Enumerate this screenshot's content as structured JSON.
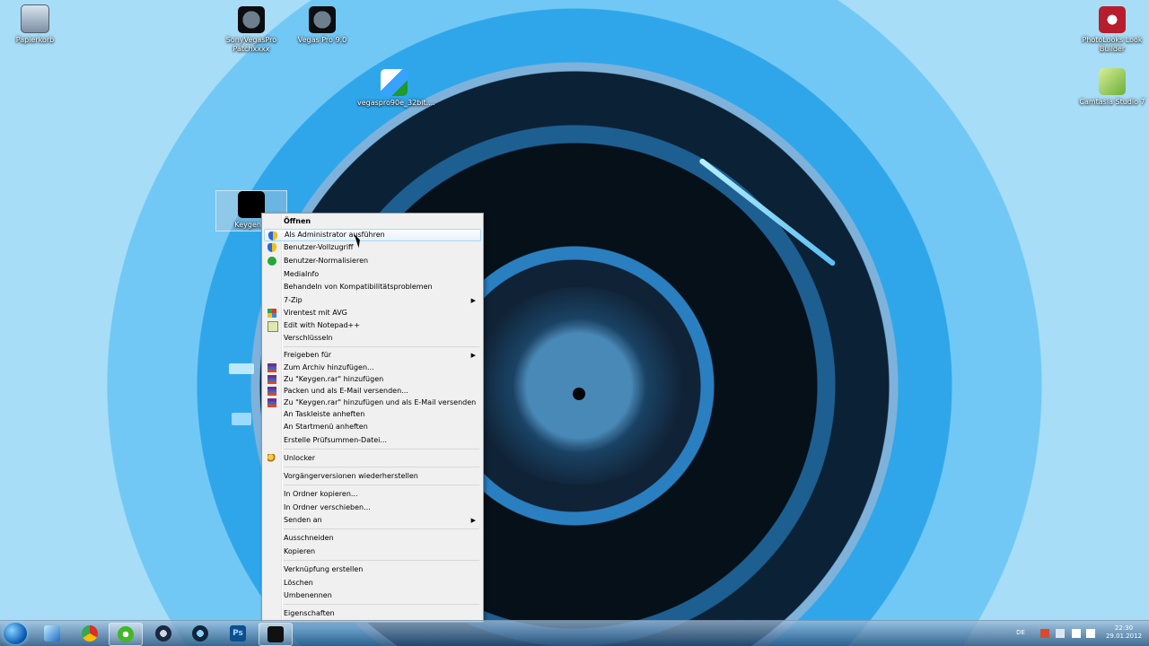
{
  "desktop": {
    "icons": [
      {
        "label": "Papierkorb",
        "icon": "recycle-bin-icon"
      },
      {
        "label": "SonyVegasPro Patchxxxx",
        "icon": "vegas-icon"
      },
      {
        "label": "Vegas Pro 9.0",
        "icon": "vegas-icon"
      },
      {
        "label": "vegaspro90e_32bit....",
        "icon": "setup-icon"
      },
      {
        "label": "Keygen...",
        "icon": "key-icon"
      },
      {
        "label": "PhotoLooks Look Builder",
        "icon": "photo-icon"
      },
      {
        "label": "Camtasia Studio 7",
        "icon": "camtasia-icon"
      }
    ]
  },
  "context_menu": {
    "items": [
      "Öffnen",
      "Als Administrator ausführen",
      "Benutzer-Vollzugriff",
      "Benutzer-Normalisieren",
      "MediaInfo",
      "Behandeln von Kompatibilitätsproblemen",
      "7-Zip",
      "Virentest mit AVG",
      "Edit with Notepad++",
      "Verschlüsseln",
      "Freigeben für",
      "Zum Archiv hinzufügen...",
      "Zu \"Keygen.rar\" hinzufügen",
      "Packen und als E-Mail versenden...",
      "Zu \"Keygen.rar\" hinzufügen und als E-Mail versenden",
      "An Taskleiste anheften",
      "An Startmenü anheften",
      "Erstelle Prüfsummen-Datei...",
      "Unlocker",
      "Vorgängerversionen wiederherstellen",
      "In Ordner kopieren...",
      "In Ordner verschieben...",
      "Senden an",
      "Ausschneiden",
      "Kopieren",
      "Verknüpfung erstellen",
      "Löschen",
      "Umbenennen",
      "Eigenschaften"
    ]
  },
  "taskbar": {
    "language": "DE",
    "time": "22:30",
    "date": "29.01.2012"
  }
}
